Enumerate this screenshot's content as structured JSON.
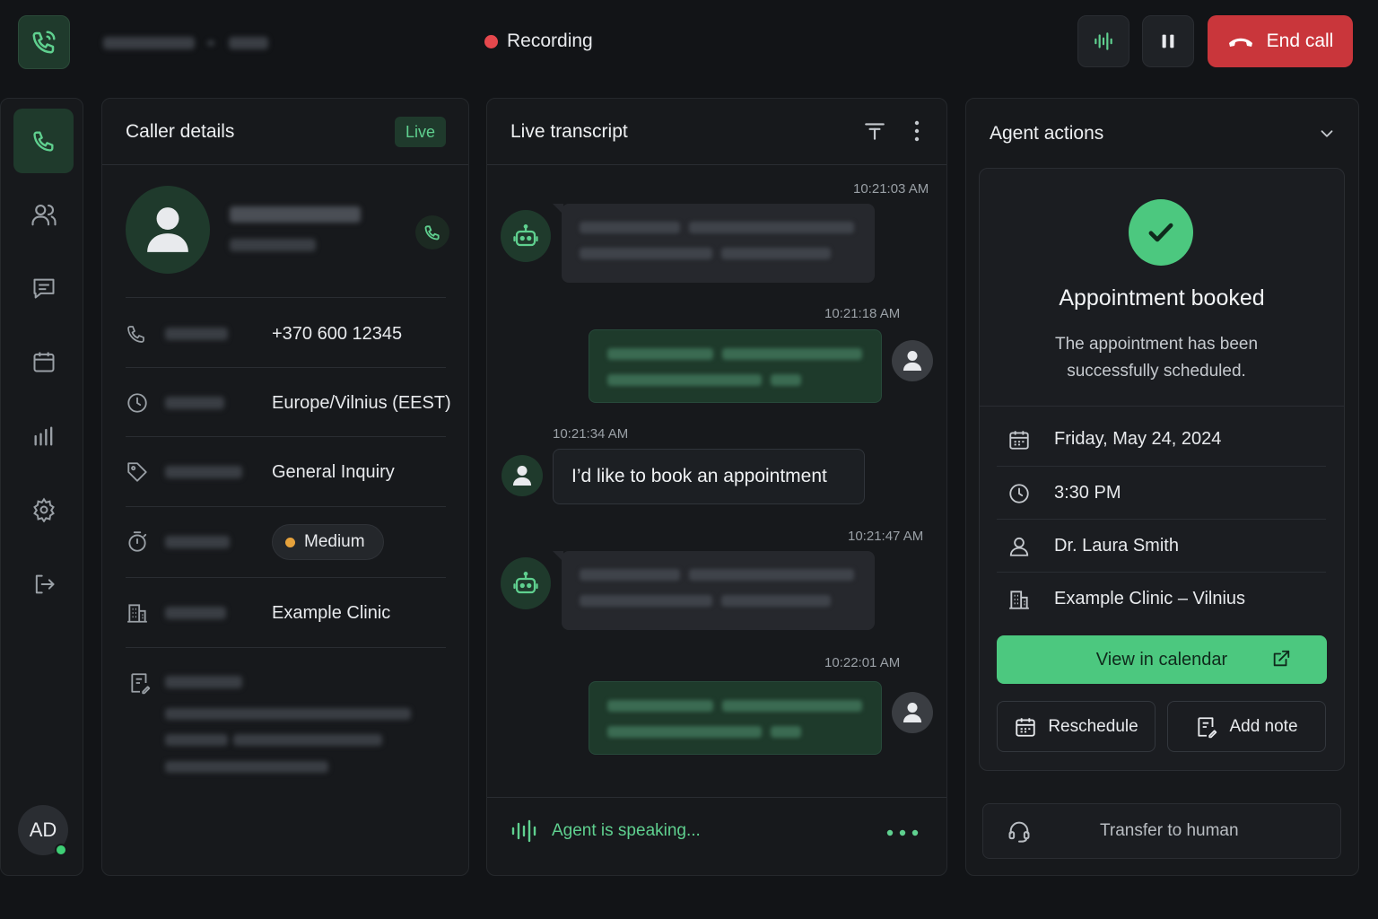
{
  "topbar": {
    "recording_label": "Recording",
    "end_call_label": "End call",
    "accent": "#4cc87f",
    "danger": "#c9363b"
  },
  "sidebar": {
    "items": [
      {
        "icon": "phone-icon",
        "active": true
      },
      {
        "icon": "contacts-icon",
        "active": false
      },
      {
        "icon": "chat-icon",
        "active": false
      },
      {
        "icon": "calendar-icon",
        "active": false
      },
      {
        "icon": "analytics-icon",
        "active": false
      },
      {
        "icon": "settings-icon",
        "active": false
      },
      {
        "icon": "logout-icon",
        "active": false
      }
    ],
    "user_initials": "AD"
  },
  "caller": {
    "title": "Caller details",
    "badge": "Live",
    "rows": [
      {
        "icon": "phone-icon",
        "value": "+370 600 12345"
      },
      {
        "icon": "clock-icon",
        "value": "Europe/Vilnius (EEST)"
      },
      {
        "icon": "tag-icon",
        "value": "General Inquiry"
      },
      {
        "icon": "timer-icon",
        "value": "Medium",
        "status_color": "#e6a23c"
      },
      {
        "icon": "building-icon",
        "value": "Example Clinic"
      },
      {
        "icon": "notes-icon",
        "value": ""
      }
    ]
  },
  "transcript": {
    "title": "Live transcript",
    "messages": [
      {
        "role": "bot",
        "time": "10:21:03 AM"
      },
      {
        "role": "agent",
        "time": "10:21:18 AM"
      },
      {
        "role": "caller",
        "time": "10:21:34 AM",
        "text": "I’d like to book an appointment"
      },
      {
        "role": "bot",
        "time": "10:21:47 AM"
      },
      {
        "role": "agent",
        "time": "10:22:01 AM"
      }
    ],
    "status": "Agent is speaking..."
  },
  "actions": {
    "title": "Agent actions",
    "success_title": "Appointment booked",
    "success_text": "The appointment has been successfully scheduled.",
    "details": [
      {
        "icon": "calendar-icon",
        "value": "Friday, May 24, 2024"
      },
      {
        "icon": "clock-icon",
        "value": "3:30 PM"
      },
      {
        "icon": "person-icon",
        "value": "Dr. Laura Smith"
      },
      {
        "icon": "building-icon",
        "value": "Example Clinic – Vilnius"
      }
    ],
    "view_calendar": "View in calendar",
    "reschedule": "Reschedule",
    "add_note": "Add note",
    "transfer": "Transfer to human"
  }
}
